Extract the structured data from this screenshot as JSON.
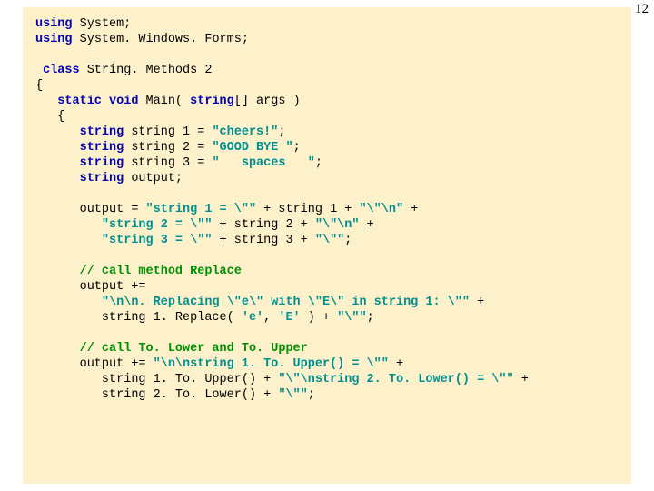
{
  "page_number": "12",
  "code": {
    "l01a": "using",
    "l01b": " System;",
    "l02a": "using",
    "l02b": " System. Windows. Forms;",
    "l03": "",
    "l04a": " class",
    "l04b": " String. Methods 2",
    "l05": "{",
    "l06a": "   static void",
    "l06b": " Main( ",
    "l06c": "string",
    "l06d": "[] args )",
    "l07": "   {",
    "l08a": "      string",
    "l08b": " string 1 = ",
    "l08c": "\"cheers!\"",
    "l08d": ";",
    "l09a": "      string",
    "l09b": " string 2 = ",
    "l09c": "\"GOOD BYE \"",
    "l09d": ";",
    "l10a": "      string",
    "l10b": " string 3 = ",
    "l10c": "\"   spaces   \"",
    "l10d": ";",
    "l11a": "      string",
    "l11b": " output;",
    "l12": "",
    "l13a": "      output = ",
    "l13b": "\"string 1 = \\\"\"",
    "l13c": " + string 1 + ",
    "l13d": "\"\\\"\\n\"",
    "l13e": " +",
    "l14a": "         ",
    "l14b": "\"string 2 = \\\"\"",
    "l14c": " + string 2 + ",
    "l14d": "\"\\\"\\n\"",
    "l14e": " +",
    "l15a": "         ",
    "l15b": "\"string 3 = \\\"\"",
    "l15c": " + string 3 + ",
    "l15d": "\"\\\"\"",
    "l15e": ";",
    "l16": "",
    "l17": "      // call method Replace",
    "l18": "      output +=",
    "l19a": "         ",
    "l19b": "\"\\n\\n. Replacing \\\"e\\\" with \\\"E\\\" in string 1: \\\"\"",
    "l19c": " +",
    "l20a": "         string 1. Replace( ",
    "l20b": "'e'",
    "l20c": ", ",
    "l20d": "'E'",
    "l20e": " ) + ",
    "l20f": "\"\\\"\"",
    "l20g": ";",
    "l21": "",
    "l22": "      // call To. Lower and To. Upper",
    "l23a": "      output += ",
    "l23b": "\"\\n\\nstring 1. To. Upper() = \\\"\"",
    "l23c": " +",
    "l24a": "         string 1. To. Upper() + ",
    "l24b": "\"\\\"\\nstring 2. To. Lower() = \\\"\"",
    "l24c": " +",
    "l25a": "         string 2. To. Lower() + ",
    "l25b": "\"\\\"\"",
    "l25c": ";"
  }
}
